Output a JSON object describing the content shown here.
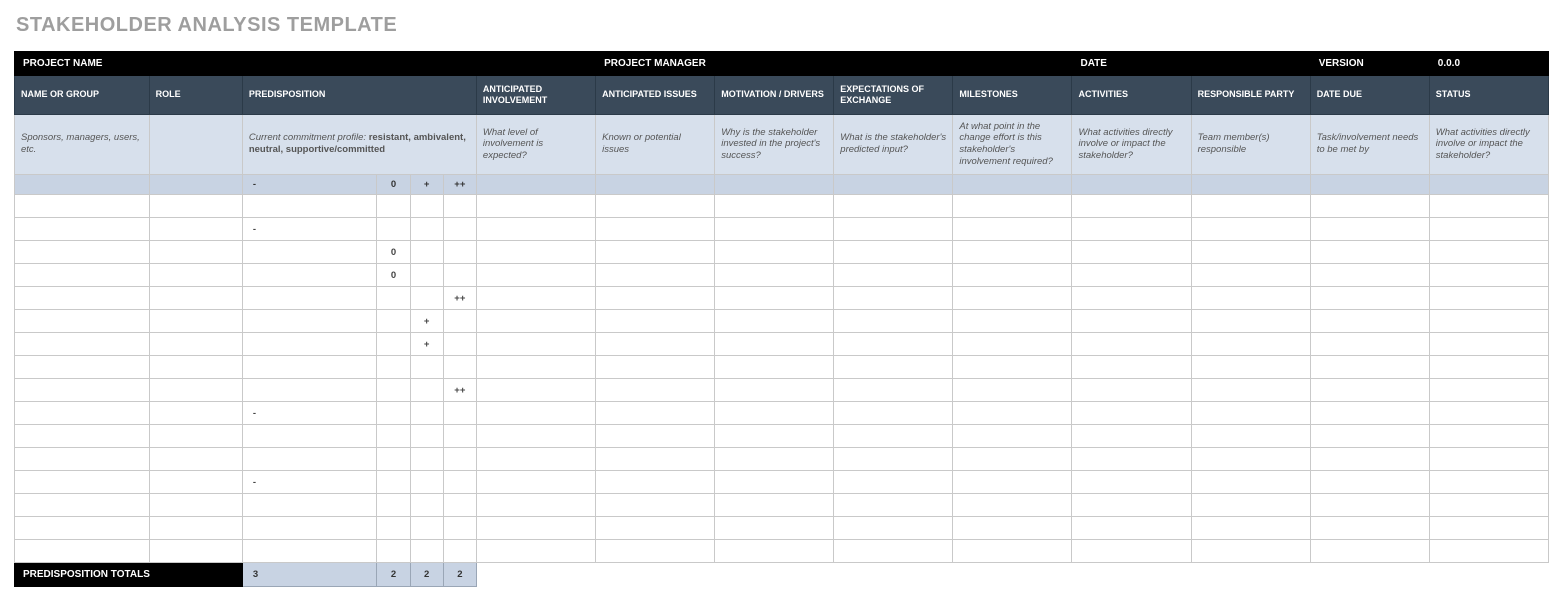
{
  "title": "STAKEHOLDER ANALYSIS TEMPLATE",
  "topHeaders": {
    "projectName": "PROJECT NAME",
    "projectManager": "PROJECT MANAGER",
    "date": "DATE",
    "version": "VERSION",
    "versionValue": "0.0.0"
  },
  "columns": {
    "name": "NAME OR GROUP",
    "role": "ROLE",
    "predisposition": "PREDISPOSITION",
    "anticipatedInvolvement": "ANTICIPATED INVOLVEMENT",
    "anticipatedIssues": "ANTICIPATED ISSUES",
    "motivation": "MOTIVATION / DRIVERS",
    "expectations": "EXPECTATIONS OF EXCHANGE",
    "milestones": "MILESTONES",
    "activities": "ACTIVITIES",
    "responsible": "RESPONSIBLE PARTY",
    "dateDue": "DATE DUE",
    "status": "STATUS"
  },
  "hints": {
    "name": "Sponsors, managers, users, etc.",
    "role": "",
    "predisposition": "Current commitment profile:  resistant, ambivalent, neutral, supportive/committed",
    "anticipatedInvolvement": "What level of involvement is expected?",
    "anticipatedIssues": "Known or potential issues",
    "motivation": "Why is the stakeholder invested in the project's success?",
    "expectations": "What is the stakeholder's predicted input?",
    "milestones": "At what point in the change effort is this stakeholder's involvement required?",
    "activities": "What activities directly involve or impact the stakeholder?",
    "responsible": "Team member(s) responsible",
    "dateDue": "Task/involvement needs to be met by",
    "status": "What activities directly involve or impact the stakeholder?"
  },
  "legend": {
    "minus": "-",
    "zero": "0",
    "plus": "+",
    "plusplus": "++"
  },
  "rows": [
    {
      "predisp": "",
      "c0": "",
      "c1": "",
      "c2": ""
    },
    {
      "predisp": "-",
      "c0": "",
      "c1": "",
      "c2": ""
    },
    {
      "predisp": "",
      "c0": "0",
      "c1": "",
      "c2": ""
    },
    {
      "predisp": "",
      "c0": "0",
      "c1": "",
      "c2": ""
    },
    {
      "predisp": "",
      "c0": "",
      "c1": "",
      "c2": "++"
    },
    {
      "predisp": "",
      "c0": "",
      "c1": "+",
      "c2": ""
    },
    {
      "predisp": "",
      "c0": "",
      "c1": "+",
      "c2": ""
    },
    {
      "predisp": "",
      "c0": "",
      "c1": "",
      "c2": ""
    },
    {
      "predisp": "",
      "c0": "",
      "c1": "",
      "c2": "++"
    },
    {
      "predisp": "-",
      "c0": "",
      "c1": "",
      "c2": ""
    },
    {
      "predisp": "",
      "c0": "",
      "c1": "",
      "c2": ""
    },
    {
      "predisp": "",
      "c0": "",
      "c1": "",
      "c2": ""
    },
    {
      "predisp": "-",
      "c0": "",
      "c1": "",
      "c2": ""
    },
    {
      "predisp": "",
      "c0": "",
      "c1": "",
      "c2": ""
    },
    {
      "predisp": "",
      "c0": "",
      "c1": "",
      "c2": ""
    },
    {
      "predisp": "",
      "c0": "",
      "c1": "",
      "c2": ""
    }
  ],
  "totals": {
    "label": "PREDISPOSITION TOTALS",
    "minus": "3",
    "zero": "2",
    "plus": "2",
    "plusplus": "2"
  }
}
